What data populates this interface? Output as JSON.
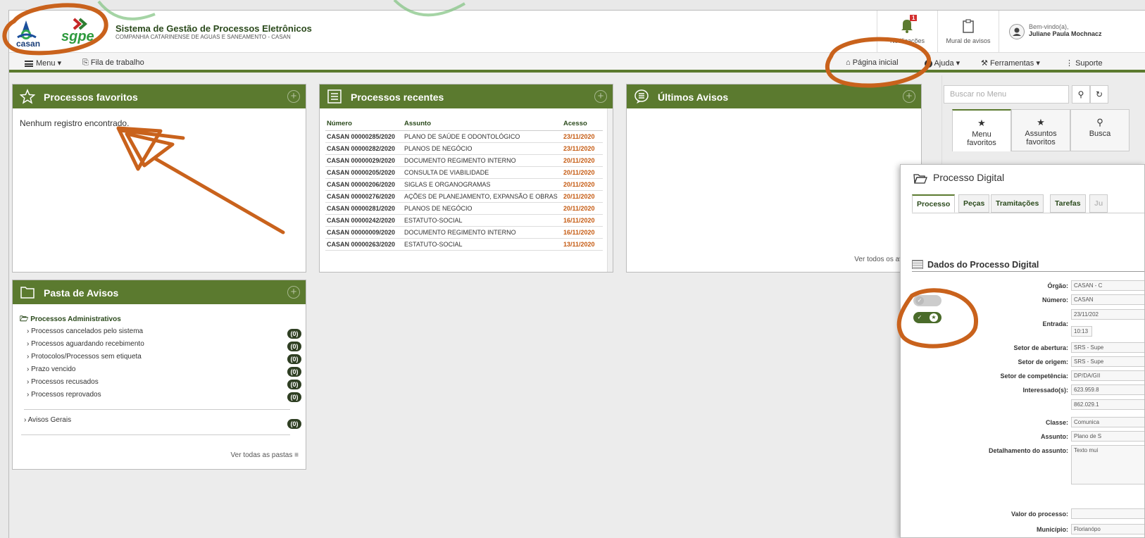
{
  "header": {
    "logo_casan_text": "casan",
    "logo_sgpe_text": "sgpe",
    "system_title": "Sistema de Gestão de Processos Eletrônicos",
    "system_subtitle": "COMPANHIA CATARINENSE DE AGUAS E SANEAMENTO - CASAN",
    "notifications_label": "Notificações",
    "notifications_count": "1",
    "mural_label": "Mural de avisos",
    "welcome_label": "Bem-vindo(a),",
    "user_name": "Juliane Paula Mochnacz"
  },
  "menubar": {
    "menu": "Menu",
    "fila": "Fila de trabalho",
    "pagina_inicial": "Página inicial",
    "ajuda": "Ajuda",
    "ferramentas": "Ferramentas",
    "suporte": "Suporte"
  },
  "favoritos": {
    "title": "Processos favoritos",
    "empty": "Nenhum registro encontrado."
  },
  "recentes": {
    "title": "Processos recentes",
    "columns": [
      "Número",
      "Assunto",
      "Acesso"
    ],
    "rows": [
      {
        "num": "CASAN 00000285/2020",
        "subj": "PLANO DE SAÚDE E ODONTOLÓGICO",
        "date": "23/11/2020"
      },
      {
        "num": "CASAN 00000282/2020",
        "subj": "PLANOS DE NEGÓCIO",
        "date": "23/11/2020"
      },
      {
        "num": "CASAN 00000029/2020",
        "subj": "DOCUMENTO REGIMENTO INTERNO",
        "date": "20/11/2020"
      },
      {
        "num": "CASAN 00000205/2020",
        "subj": "CONSULTA DE VIABILIDADE",
        "date": "20/11/2020"
      },
      {
        "num": "CASAN 00000206/2020",
        "subj": "SIGLAS E ORGANOGRAMAS",
        "date": "20/11/2020"
      },
      {
        "num": "CASAN 00000276/2020",
        "subj": "AÇÕES DE PLANEJAMENTO, EXPANSÃO E OBRAS",
        "date": "20/11/2020"
      },
      {
        "num": "CASAN 00000281/2020",
        "subj": "PLANOS DE NEGÓCIO",
        "date": "20/11/2020"
      },
      {
        "num": "CASAN 00000242/2020",
        "subj": "ESTATUTO-SOCIAL",
        "date": "16/11/2020"
      },
      {
        "num": "CASAN 00000009/2020",
        "subj": "DOCUMENTO REGIMENTO INTERNO",
        "date": "16/11/2020"
      },
      {
        "num": "CASAN 00000263/2020",
        "subj": "ESTATUTO-SOCIAL",
        "date": "13/11/2020"
      }
    ]
  },
  "avisos": {
    "title": "Últimos Avisos",
    "ver_todos": "Ver todos os avisos"
  },
  "pasta": {
    "title": "Pasta de Avisos",
    "root": "Processos Administrativos",
    "items": [
      {
        "label": "Processos cancelados pelo sistema",
        "count": "(0)"
      },
      {
        "label": "Processos aguardando recebimento",
        "count": "(0)"
      },
      {
        "label": "Protocolos/Processos sem etiqueta",
        "count": "(0)"
      },
      {
        "label": "Prazo vencido",
        "count": "(0)"
      },
      {
        "label": "Processos recusados",
        "count": "(0)"
      },
      {
        "label": "Processos reprovados",
        "count": "(0)"
      }
    ],
    "gerais": {
      "label": "Avisos Gerais",
      "count": "(0)"
    },
    "ver_todas": "Ver todas as pastas"
  },
  "sidebar": {
    "search_placeholder": "Buscar no Menu",
    "tabs": [
      {
        "line1": "Menu",
        "line2": "favoritos"
      },
      {
        "line1": "Assuntos",
        "line2": "favoritos"
      },
      {
        "line1": "Busca",
        "line2": ""
      }
    ]
  },
  "processo_digital": {
    "title": "Processo Digital",
    "tabs": [
      "Processo",
      "Peças",
      "Tramitações",
      "Tarefas",
      "Ju"
    ],
    "section_title": "Dados do Processo Digital",
    "fields": [
      {
        "label": "Órgão:",
        "value": "CASAN - C"
      },
      {
        "label": "Número:",
        "value": "CASAN"
      },
      {
        "label": "Entrada:",
        "value": "23/11/202"
      },
      {
        "label": "",
        "value": "10:13"
      },
      {
        "label": "Setor de abertura:",
        "value": "SRS - Supe"
      },
      {
        "label": "Setor de origem:",
        "value": "SRS - Supe"
      },
      {
        "label": "Setor de competência:",
        "value": "DP/DA/GII"
      },
      {
        "label": "Interessado(s):",
        "value": "623.959.8"
      },
      {
        "label": "",
        "value": "862.029.1"
      },
      {
        "label": "Classe:",
        "value": "Comunica"
      },
      {
        "label": "Assunto:",
        "value": "Plano de S"
      },
      {
        "label": "Detalhamento do assunto:",
        "value": "Texto mui"
      },
      {
        "label": "Valor do processo:",
        "value": ""
      },
      {
        "label": "Município:",
        "value": "Florianópo"
      }
    ]
  },
  "colors": {
    "brand_green": "#5b7a2f",
    "annotation_orange": "#c9621c",
    "date_orange": "#c55a11"
  }
}
